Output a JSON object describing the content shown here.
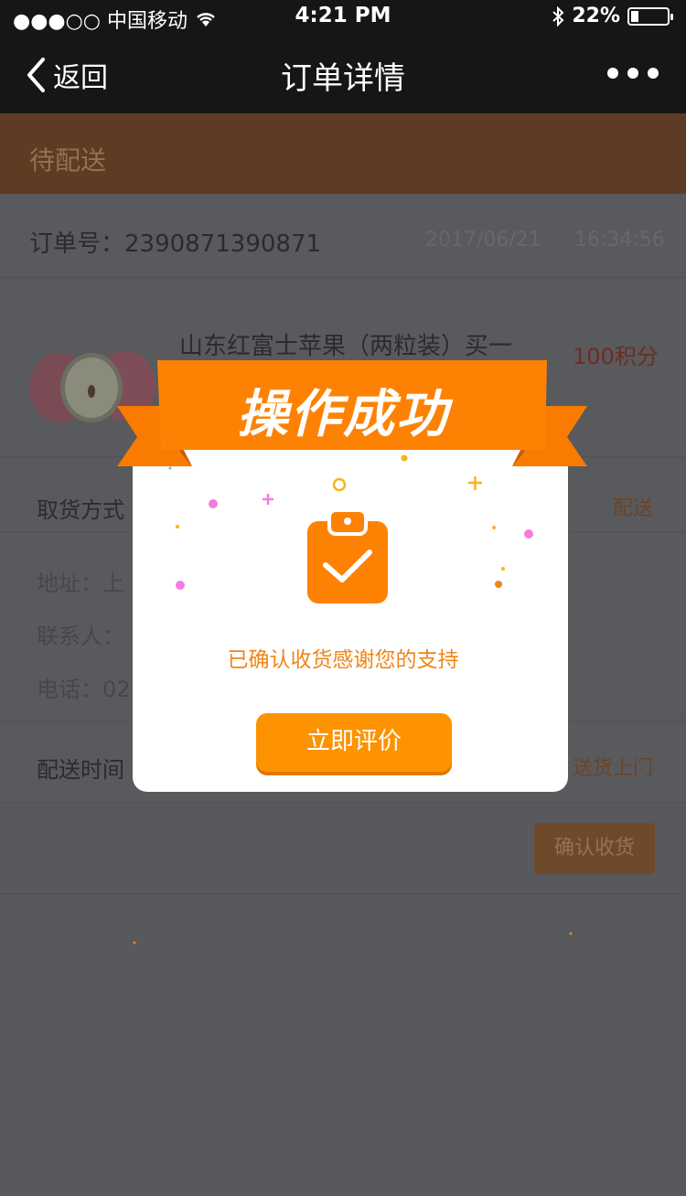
{
  "status_bar": {
    "carrier": "●●●○○ 中国移动",
    "time": "4:21 PM",
    "battery": "22%",
    "battery_level": 0.22
  },
  "nav": {
    "back_label": "返回",
    "title": "订单详情"
  },
  "order": {
    "status": "待配送",
    "number": "订单号：2390871390871",
    "date": "2017/06/21",
    "time": "16:34:56",
    "product_name": "山东红富士苹果（两粒装）买一",
    "product_price": "100积分",
    "pickup_label": "取货方式",
    "pickup_value": "配送",
    "address_label": "地址：上",
    "contact_label": "联系人：",
    "phone_label": "电话：02",
    "delivery_time_label": "配送时间",
    "delivery_time_value": "送货上门",
    "confirm_button": "确认收货"
  },
  "modal": {
    "title": "操作成功",
    "message": "已确认收货感谢您的支持",
    "review_button": "立即评价",
    "ribbon_color": "#fd8204",
    "accent_color": "#fd9301"
  }
}
